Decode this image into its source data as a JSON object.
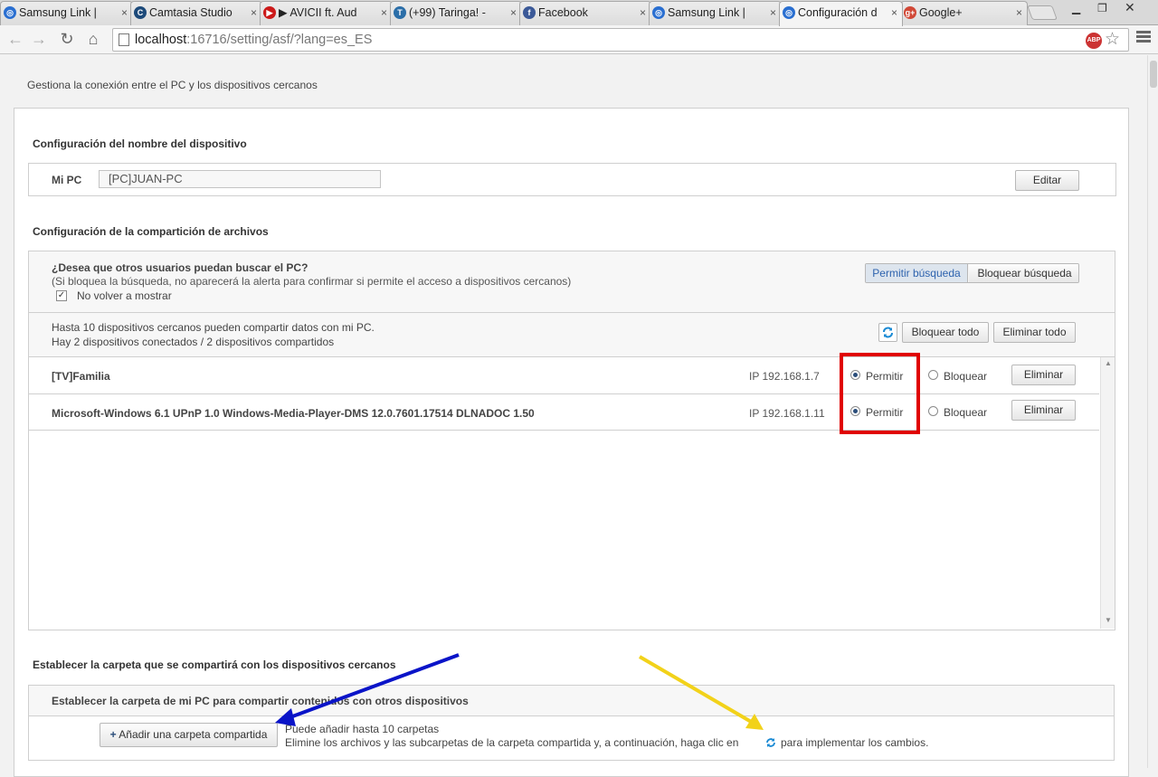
{
  "browser": {
    "tabs": [
      {
        "title": "Samsung Link |",
        "icon": "samsung-link-icon",
        "color": "#2a6fd1"
      },
      {
        "title": "Camtasia Studio",
        "icon": "camtasia-icon",
        "color": "#1d4a7a"
      },
      {
        "title": "▶ AVICII ft. Aud",
        "icon": "youtube-icon",
        "color": "#cc1a1a"
      },
      {
        "title": "(+99) Taringa! -",
        "icon": "taringa-icon",
        "color": "#2b6ea8"
      },
      {
        "title": "Facebook",
        "icon": "facebook-icon",
        "color": "#3b5998"
      },
      {
        "title": "Samsung Link |",
        "icon": "samsung-link-icon",
        "color": "#2a6fd1"
      },
      {
        "title": "Configuración d",
        "icon": "samsung-link-icon",
        "color": "#2a6fd1"
      },
      {
        "title": "Google+",
        "icon": "google-plus-icon",
        "color": "#d14836"
      }
    ],
    "close_glyph": "×",
    "url_host": "localhost",
    "url_rest": ":16716/setting/asf/?lang=es_ES",
    "abp_label": "ABP"
  },
  "page": {
    "subtitle": "Gestiona la conexión entre el PC y los dispositivos cercanos",
    "device_name_section": {
      "title": "Configuración del nombre del dispositivo",
      "label": "Mi PC",
      "value": "[PC]JUAN-PC",
      "edit_button": "Editar"
    },
    "sharing_section": {
      "title": "Configuración de la compartición de archivos",
      "question": "¿Desea que otros usuarios puedan buscar el PC?",
      "question_note": "(Si bloquea la búsqueda, no aparecerá la alerta para confirmar si permite el acceso a dispositivos cercanos)",
      "no_show_checkbox": "No volver a mostrar",
      "no_show_checked": true,
      "allow_search_button": "Permitir búsqueda",
      "block_search_button": "Bloquear búsqueda",
      "limit_text": "Hasta 10 dispositivos cercanos pueden compartir datos con mi PC.",
      "status_text": "Hay 2 dispositivos conectados / 2 dispositivos compartidos",
      "block_all_button": "Bloquear todo",
      "delete_all_button": "Eliminar todo",
      "devices": [
        {
          "name": "[TV]Familia",
          "ip": "IP 192.168.1.7",
          "allow": "Permitir",
          "block": "Bloquear",
          "selected": "allow",
          "delete": "Eliminar"
        },
        {
          "name": "Microsoft-Windows 6.1 UPnP 1.0 Windows-Media-Player-DMS 12.0.7601.17514 DLNADOC 1.50",
          "ip": "IP 192.168.1.11",
          "allow": "Permitir",
          "block": "Bloquear",
          "selected": "allow",
          "delete": "Eliminar"
        }
      ]
    },
    "folder_section": {
      "title": "Establecer la carpeta que se compartirá con los dispositivos cercanos",
      "subtitle": "Establecer la carpeta de mi PC para compartir contenidos con otros dispositivos",
      "add_button": "Añadir una carpeta compartida",
      "add_plus": "+",
      "hint_line1": "Puede añadir hasta 10 carpetas",
      "hint_line2_before": "Elimine los archivos y las subcarpetas de la carpeta compartida y, a continuación, haga clic en",
      "hint_line2_after": "para implementar los cambios."
    },
    "annotations": {
      "highlight_color": "#e00000",
      "blue_arrow_color": "#0a14c8",
      "yellow_arrow_color": "#f2d21a"
    }
  }
}
